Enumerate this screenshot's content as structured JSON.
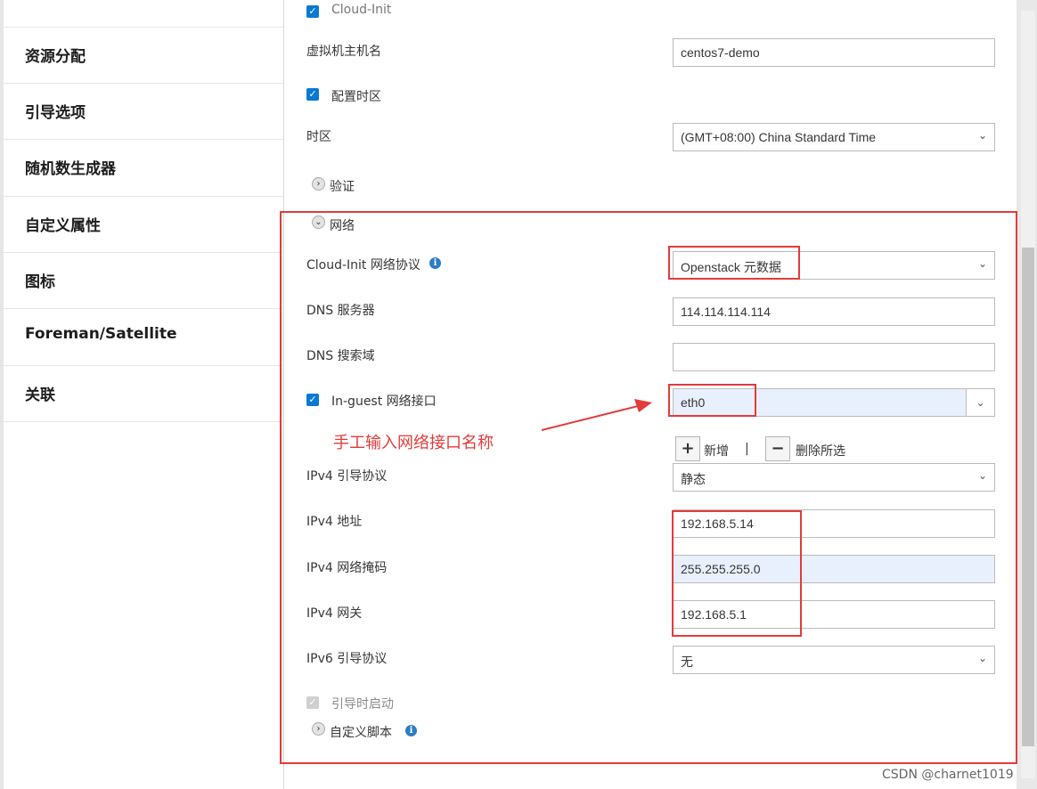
{
  "sidebar": {
    "items": [
      {
        "label": "资源分配"
      },
      {
        "label": "引导选项"
      },
      {
        "label": "随机数生成器"
      },
      {
        "label": "自定义属性"
      },
      {
        "label": "图标"
      },
      {
        "label": "Foreman/Satellite"
      },
      {
        "label": "关联"
      }
    ]
  },
  "form": {
    "cloud_init_label": "Cloud-Init",
    "hostname": {
      "label": "虚拟机主机名",
      "value": "centos7-demo"
    },
    "timezone_checkbox": {
      "label": "配置时区",
      "checked": true
    },
    "timezone": {
      "label": "时区",
      "value": "(GMT+08:00) China Standard Time"
    },
    "auth_section": {
      "label": "验证"
    },
    "network_section": {
      "label": "网络"
    },
    "network_protocol": {
      "label": "Cloud-Init 网络协议",
      "value": "Openstack 元数据"
    },
    "dns_server": {
      "label": "DNS 服务器",
      "value": "114.114.114.114"
    },
    "dns_search": {
      "label": "DNS 搜索域",
      "value": ""
    },
    "in_guest": {
      "label": "In-guest 网络接口",
      "value": "eth0",
      "checked": true
    },
    "add_label": "新增",
    "separator": "|",
    "delete_label": "删除所选",
    "ipv4_boot": {
      "label": "IPv4 引导协议",
      "value": "静态"
    },
    "ipv4_addr": {
      "label": "IPv4 地址",
      "value": "192.168.5.14"
    },
    "ipv4_mask": {
      "label": "IPv4 网络掩码",
      "value": "255.255.255.0"
    },
    "ipv4_gw": {
      "label": "IPv4 网关",
      "value": "192.168.5.1"
    },
    "ipv6_boot": {
      "label": "IPv6 引导协议",
      "value": "无"
    },
    "boot_start": {
      "label": "引导时启动",
      "checked": true
    },
    "custom_script": {
      "label": "自定义脚本"
    }
  },
  "annotation": {
    "text": "手工输入网络接口名称"
  },
  "watermark": {
    "text": "CSDN @charnet1019"
  },
  "colors": {
    "accent": "#0a79d4",
    "annotation": "#e23b3b",
    "highlight": "#e8f0fe"
  },
  "icons": {
    "checkbox": "check-icon",
    "expand": "chevron-right-icon",
    "collapse": "chevron-down-icon",
    "info": "info-icon",
    "add": "plus-icon",
    "remove": "minus-icon"
  }
}
